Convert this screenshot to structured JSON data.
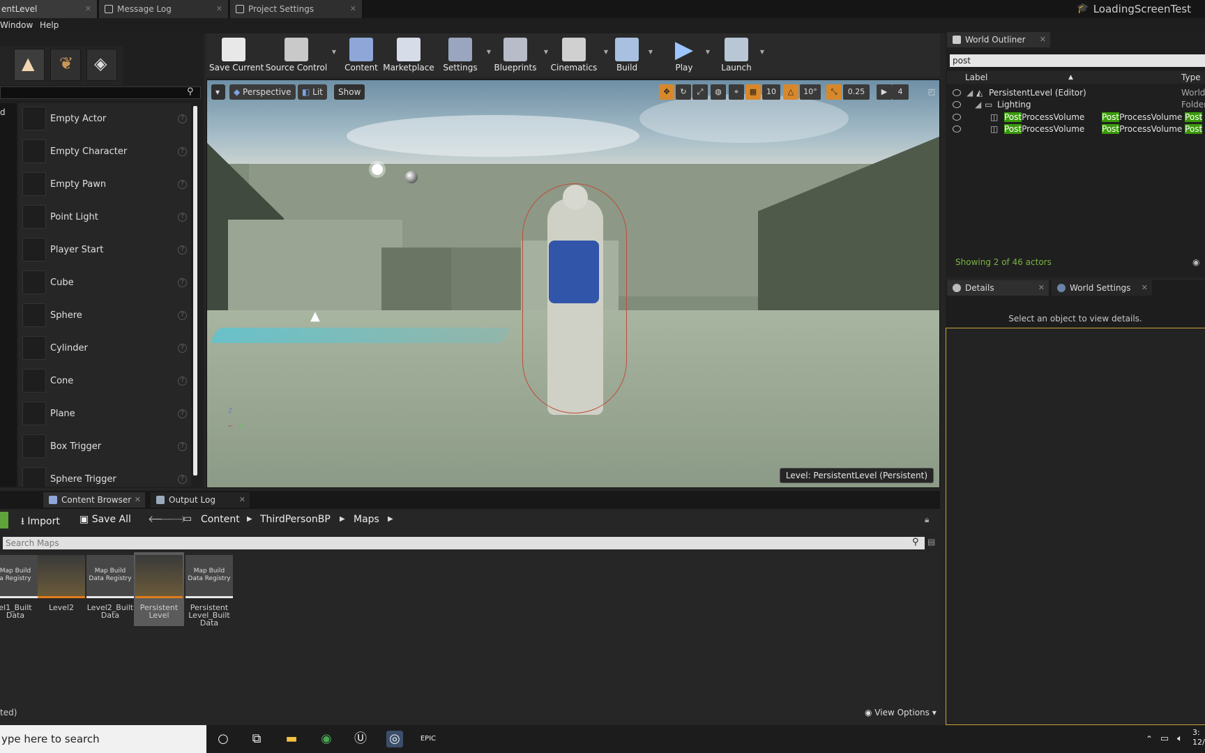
{
  "tabs": [
    {
      "label": "entLevel",
      "active": true
    },
    {
      "label": "Message Log",
      "active": false
    },
    {
      "label": "Project Settings",
      "active": false
    }
  ],
  "project_name": "LoadingScreenTest",
  "menu": {
    "window": "Window",
    "help": "Help"
  },
  "place_items": [
    "Empty Actor",
    "Empty Character",
    "Empty Pawn",
    "Point Light",
    "Player Start",
    "Cube",
    "Sphere",
    "Cylinder",
    "Cone",
    "Plane",
    "Box Trigger",
    "Sphere Trigger"
  ],
  "category_label": "d",
  "toolbar": [
    {
      "label": "Save Current"
    },
    {
      "label": "Source Control"
    },
    {
      "label": "Content"
    },
    {
      "label": "Marketplace"
    },
    {
      "label": "Settings"
    },
    {
      "label": "Blueprints"
    },
    {
      "label": "Cinematics"
    },
    {
      "label": "Build"
    },
    {
      "label": "Play"
    },
    {
      "label": "Launch"
    }
  ],
  "viewport": {
    "perspective": "Perspective",
    "lit": "Lit",
    "show": "Show",
    "grid_snap": "10",
    "rot_snap": "10°",
    "scale_snap": "0.25",
    "cam_speed": "4",
    "level_label": "Level:  PersistentLevel (Persistent)"
  },
  "outliner": {
    "tab": "World Outliner",
    "search": "post",
    "col_label": "Label",
    "col_type": "Type",
    "rows": [
      {
        "label": "PersistentLevel (Editor)",
        "type": "World"
      },
      {
        "label": "Lighting",
        "type": "Folder"
      },
      {
        "hl": "Post",
        "rest": "ProcessVolume",
        "type_hl": "Post",
        "type_rest": "ProcessVolume",
        "type2": "Post"
      },
      {
        "hl": "Post",
        "rest": "ProcessVolume",
        "type_hl": "Post",
        "type_rest": "ProcessVolume",
        "type2": "Post"
      }
    ],
    "status": "Showing 2 of 46 actors"
  },
  "details": {
    "tab": "Details",
    "tab2": "World Settings",
    "message": "Select an object to view details."
  },
  "content_browser": {
    "tab": "Content Browser",
    "tab2": "Output Log",
    "import": "Import",
    "save_all": "Save All",
    "path": [
      "Content",
      "ThirdPersonBP",
      "Maps"
    ],
    "search_placeholder": "Search Maps",
    "assets": [
      {
        "thumb": "Map Build\na Registry",
        "caption": "el1_Built\nData",
        "kind": "reg"
      },
      {
        "thumb": "",
        "caption": "Level2",
        "kind": "map"
      },
      {
        "thumb": "Map Build\nData Registry",
        "caption": "Level2_Built\nData",
        "kind": "reg"
      },
      {
        "thumb": "",
        "caption": "Persistent\nLevel",
        "kind": "map",
        "selected": true
      },
      {
        "thumb": "Map Build\nData Registry",
        "caption": "Persistent\nLevel_Built\nData",
        "kind": "reg"
      }
    ],
    "view_options": "View Options",
    "footer": "ted)"
  },
  "taskbar": {
    "search": "ype here to search",
    "clock": "3:\n12/"
  }
}
